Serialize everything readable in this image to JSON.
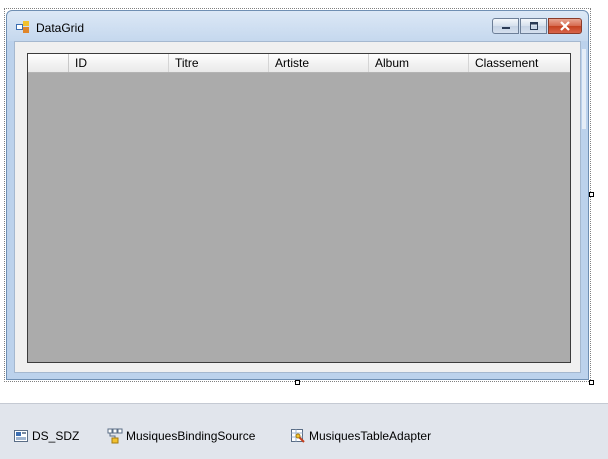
{
  "window": {
    "title": "DataGrid",
    "icons": [
      "form-icon",
      "minimize-icon",
      "maximize-icon",
      "close-icon"
    ]
  },
  "grid": {
    "columns": [
      "ID",
      "Titre",
      "Artiste",
      "Album",
      "Classement"
    ],
    "rows": []
  },
  "tray": {
    "items": [
      {
        "label": "DS_SDZ",
        "icon": "dataset-icon"
      },
      {
        "label": "MusiquesBindingSource",
        "icon": "binding-source-icon"
      },
      {
        "label": "MusiquesTableAdapter",
        "icon": "table-adapter-icon"
      }
    ]
  },
  "colors": {
    "grid_background": "#ababab",
    "close_button": "#c4401f",
    "tray_background": "#e1e5ec"
  }
}
